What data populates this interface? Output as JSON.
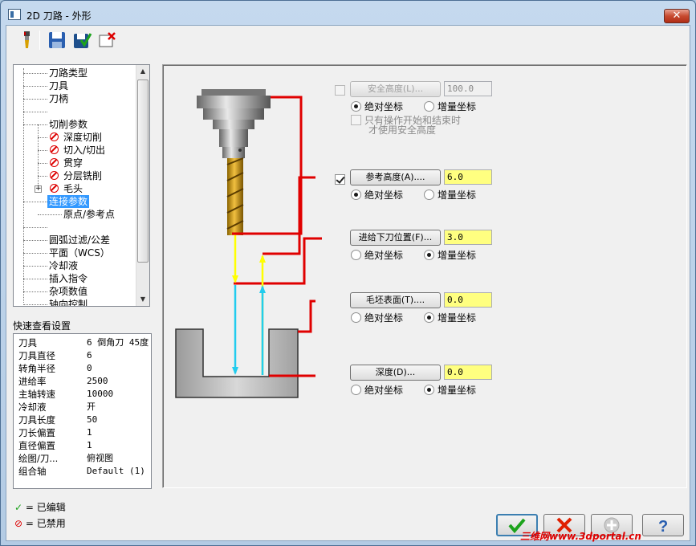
{
  "window": {
    "title": "2D 刀路 - 外形",
    "close": "✕"
  },
  "toolbar": {
    "items": [
      "tool-icon",
      "save-icon",
      "save-load-icon",
      "delete-icon"
    ]
  },
  "tree": {
    "items": [
      {
        "label": "刀路类型",
        "state": "none"
      },
      {
        "label": "刀具",
        "state": "none"
      },
      {
        "label": "刀柄",
        "state": "none"
      },
      {
        "label": "",
        "state": "none"
      },
      {
        "label": "切削参数",
        "state": "none"
      },
      {
        "label": "深度切削",
        "state": "disabled"
      },
      {
        "label": "切入/切出",
        "state": "disabled"
      },
      {
        "label": "贯穿",
        "state": "disabled"
      },
      {
        "label": "分层铣削",
        "state": "disabled"
      },
      {
        "label": "毛头",
        "state": "disabled"
      },
      {
        "label": "连接参数",
        "state": "selected"
      },
      {
        "label": "原点/参考点",
        "state": "none"
      },
      {
        "label": "",
        "state": "none"
      },
      {
        "label": "圆弧过滤/公差",
        "state": "none"
      },
      {
        "label": "平面（WCS）",
        "state": "none"
      },
      {
        "label": "冷却液",
        "state": "none"
      },
      {
        "label": "插入指令",
        "state": "none"
      },
      {
        "label": "杂项数值",
        "state": "none"
      },
      {
        "label": "轴向控制",
        "state": "none"
      }
    ]
  },
  "quick": {
    "label": "快速查看设置",
    "rows": [
      {
        "k": "刀具",
        "v": "6 倒角刀 45度"
      },
      {
        "k": "刀具直径",
        "v": "6"
      },
      {
        "k": "转角半径",
        "v": "0"
      },
      {
        "k": "进给率",
        "v": "2500"
      },
      {
        "k": "主轴转速",
        "v": "10000"
      },
      {
        "k": "冷却液",
        "v": "开"
      },
      {
        "k": "刀具长度",
        "v": "50"
      },
      {
        "k": "刀长偏置",
        "v": "1"
      },
      {
        "k": "直径偏置",
        "v": "1"
      },
      {
        "k": "绘图/刀...",
        "v": "俯视图"
      },
      {
        "k": "组合轴",
        "v": "Default (1)"
      }
    ]
  },
  "params": {
    "clearance": {
      "label": "安全高度(L)...",
      "value": "100.0",
      "abs": "绝对坐标",
      "inc": "增量坐标",
      "only": "只有操作开始和结束时",
      "only2": "才使用安全高度"
    },
    "retract": {
      "label": "参考高度(A)....",
      "value": "6.0",
      "abs": "绝对坐标",
      "inc": "增量坐标"
    },
    "feed": {
      "label": "进给下刀位置(F)...",
      "value": "3.0",
      "abs": "绝对坐标",
      "inc": "增量坐标"
    },
    "top": {
      "label": "毛坯表面(T)....",
      "value": "0.0",
      "abs": "绝对坐标",
      "inc": "增量坐标"
    },
    "depth": {
      "label": "深度(D)...",
      "value": "0.0",
      "abs": "绝对坐标",
      "inc": "增量坐标"
    }
  },
  "legend": {
    "edited": "= 已编辑",
    "disabled": "= 已禁用"
  },
  "watermark": "三维网www.3dportal.cn",
  "colors": {
    "accent": "#3399ff",
    "field": "#ffff80",
    "leader": "#e00000",
    "arrow_feed": "#ffff00",
    "arrow_cyan": "#22ccee"
  }
}
